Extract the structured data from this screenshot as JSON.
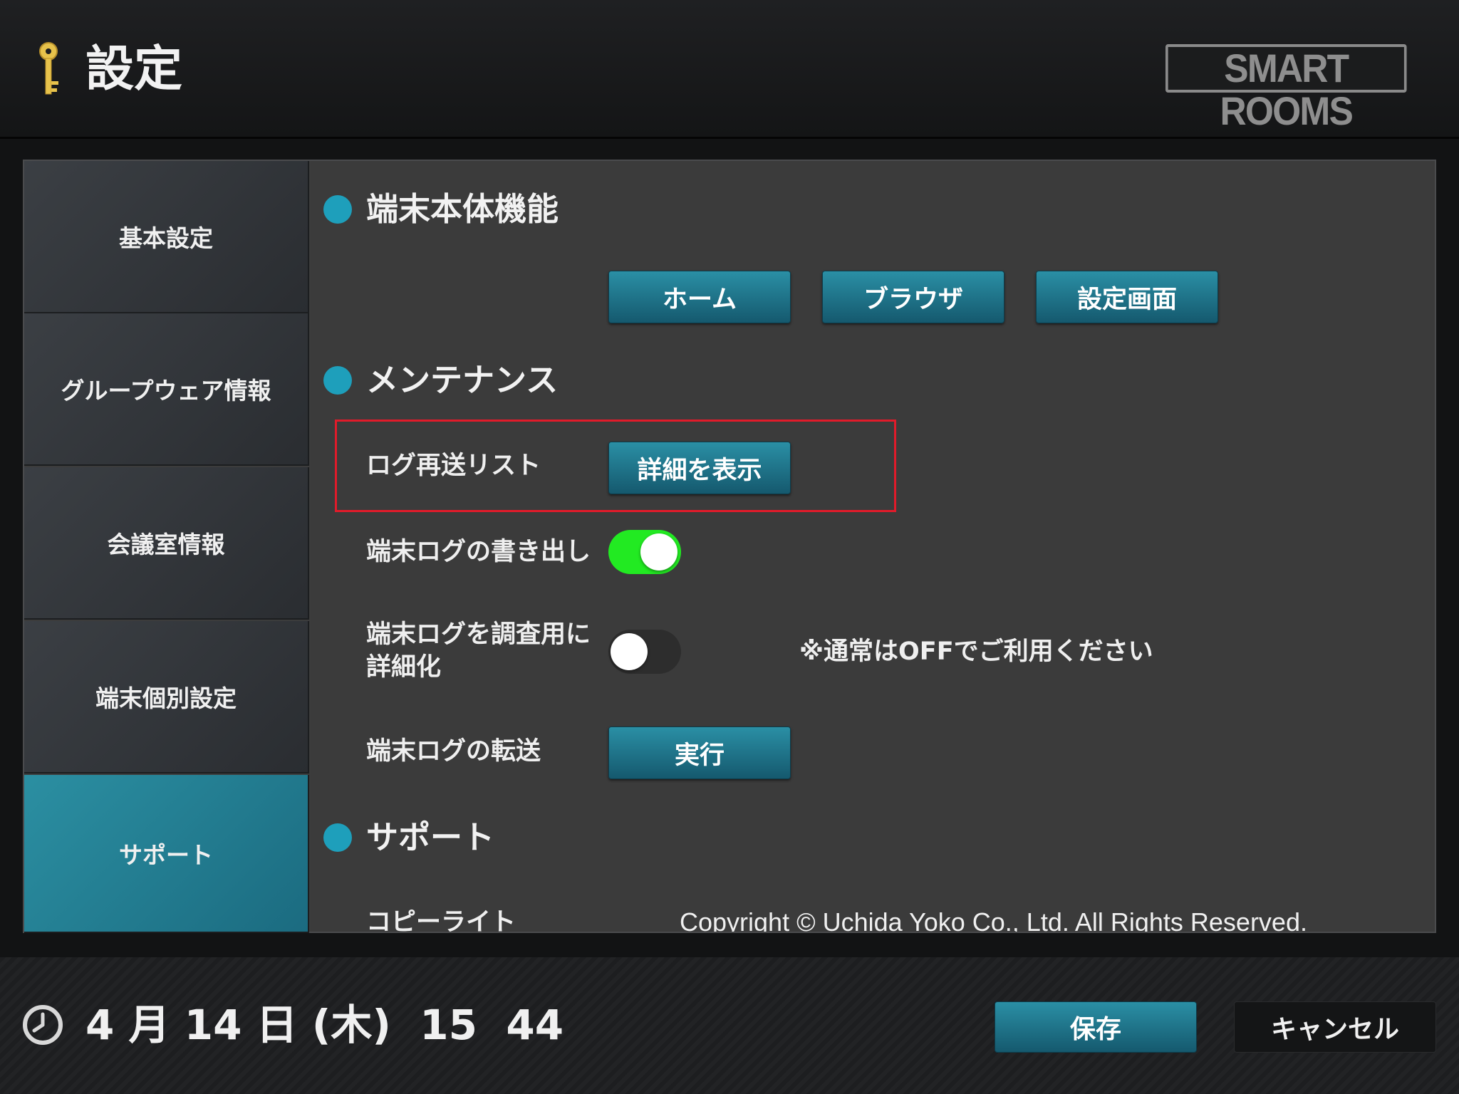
{
  "header": {
    "title": "設定",
    "key_icon": "key-icon",
    "logo_text": "SMART ROOMS"
  },
  "sidebar": {
    "items": [
      {
        "label": "基本設定",
        "active": false
      },
      {
        "label": "グループウェア情報",
        "active": false
      },
      {
        "label": "会議室情報",
        "active": false
      },
      {
        "label": "端末個別設定",
        "active": false
      },
      {
        "label": "サポート",
        "active": true
      }
    ]
  },
  "sections": {
    "device": {
      "title": "端末本体機能",
      "buttons": [
        "ホーム",
        "ブラウザ",
        "設定画面"
      ]
    },
    "maintenance": {
      "title": "メンテナンス",
      "log_resend_label": "ログ再送リスト",
      "log_resend_button": "詳細を表示",
      "log_export_label": "端末ログの書き出し",
      "log_export_on": true,
      "log_detail_label_line1": "端末ログを調査用に",
      "log_detail_label_line2": "詳細化",
      "log_detail_on": false,
      "log_detail_note": "※通常はOFFでご利用ください",
      "log_transfer_label": "端末ログの転送",
      "log_transfer_button": "実行"
    },
    "support": {
      "title": "サポート",
      "copyright_label": "コピーライト",
      "copyright_value": "Copyright © Uchida Yoko Co., Ltd. All Rights Reserved."
    }
  },
  "footer": {
    "clock_icon": "clock-icon",
    "datetime": "4 月 14 日 (木)  15  44",
    "save_label": "保存",
    "cancel_label": "キャンセル"
  },
  "colors": {
    "accent": "#1e9fbb",
    "toggle_on": "#22ea22",
    "highlight_border": "#e11b2a"
  }
}
